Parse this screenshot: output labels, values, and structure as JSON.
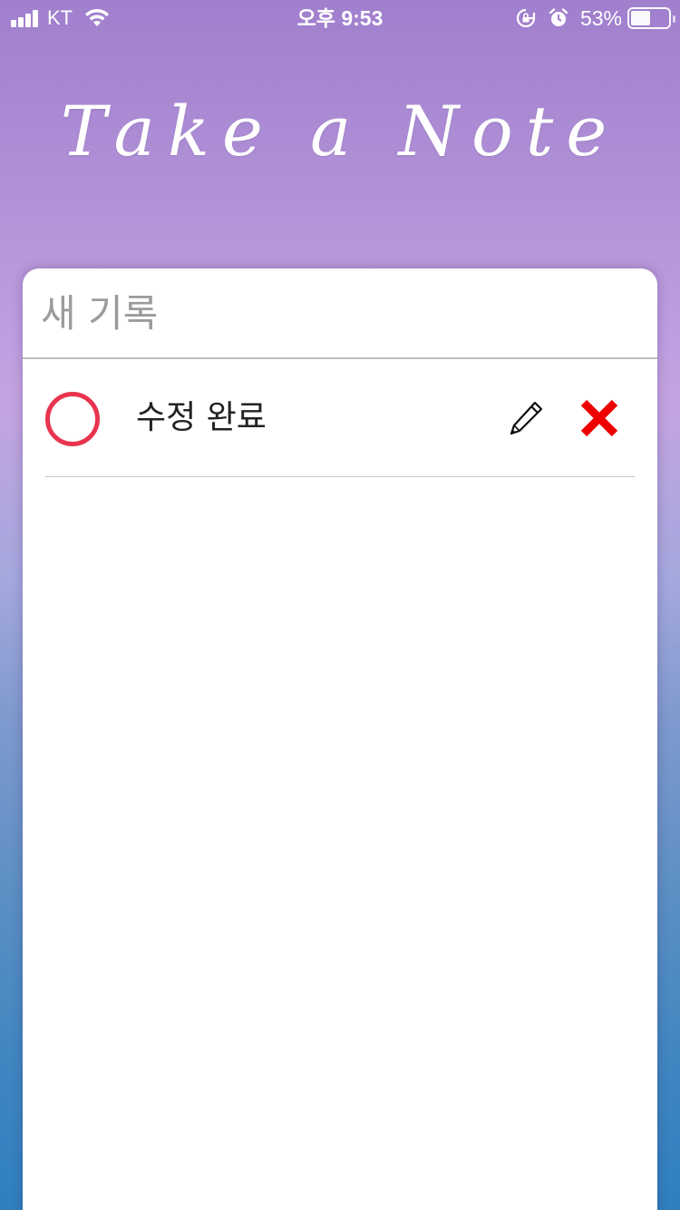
{
  "status_bar": {
    "carrier": "KT",
    "time": "오후 9:53",
    "battery_percent": "53%",
    "battery_level": 0.53,
    "icons": [
      "signal-icon",
      "wifi-icon",
      "rotation-lock-icon",
      "alarm-icon",
      "battery-icon"
    ]
  },
  "app": {
    "title": "Take a Note"
  },
  "new_note": {
    "placeholder": "새 기록",
    "value": ""
  },
  "todos": [
    {
      "text": "수정 완료",
      "completed": false,
      "icons": {
        "check": "circle-outline-icon",
        "edit": "pencil-icon",
        "delete": "close-x-icon"
      }
    }
  ],
  "colors": {
    "accent_circle": "#e8344f",
    "delete": "#ee0000",
    "gradient_top": "#a07fcd",
    "gradient_bottom": "#2f7fbe"
  }
}
